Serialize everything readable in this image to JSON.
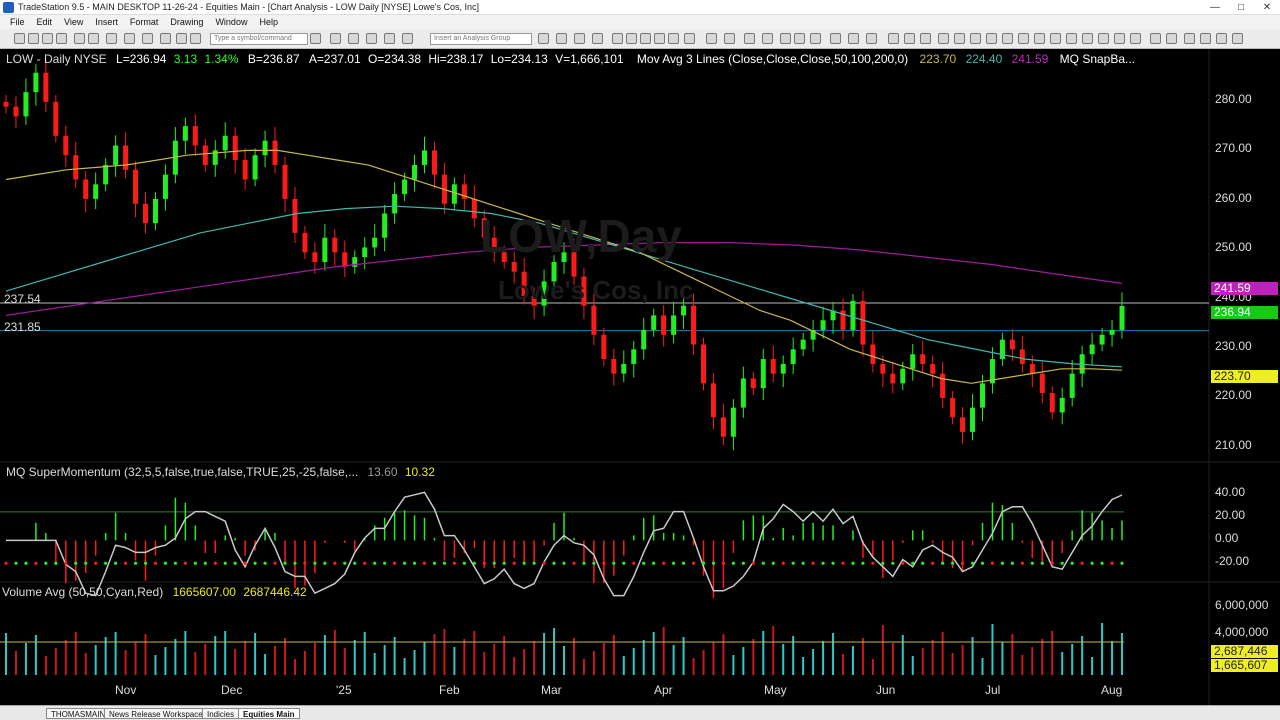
{
  "window": {
    "title": "TradeStation 9.5 - MAIN DESKTOP 11-26-24 - Equities Main - [Chart Analysis - LOW Daily [NYSE] Lowe's Cos, Inc]"
  },
  "menu": [
    "File",
    "Edit",
    "View",
    "Insert",
    "Format",
    "Drawing",
    "Window",
    "Help"
  ],
  "toolbar": {
    "symbol_placeholder": "Type a symbol/command",
    "analysis_placeholder": "Insert an Analysis Group"
  },
  "price_header": {
    "symbol": "LOW - Daily  NYSE",
    "last": "L=236.94",
    "change": "3.13",
    "pct": "1.34%",
    "bid": "B=236.87",
    "ask": "A=237.01",
    "open": "O=234.38",
    "high": "Hi=238.17",
    "low": "Lo=234.13",
    "volume": "V=1,666,101",
    "study": "Mov Avg 3 Lines (Close,Close,Close,50,100,200,0)",
    "ma1": "223.70",
    "ma2": "224.40",
    "ma3": "241.59",
    "snap": "MQ SnapBa..."
  },
  "watermark": {
    "symbol": "LOW,Day",
    "name": "Lowe's Cos, Inc"
  },
  "price_axis": [
    "280.00",
    "270.00",
    "260.00",
    "250.00",
    "240.00",
    "230.00",
    "220.00",
    "210.00"
  ],
  "price_levels": [
    "237.54",
    "231.85"
  ],
  "price_tags": {
    "ma200": "241.59",
    "last": "236.94",
    "ma50": "223.70"
  },
  "momentum": {
    "label": "MQ SuperMomentum (32,5,5,false,true,false,TRUE,25,-25,false,...",
    "v1": "13.60",
    "v2": "10.32",
    "axis": [
      "40.00",
      "20.00",
      "0.00",
      "-20.00"
    ]
  },
  "volume": {
    "label": "Volume Avg (50,50,Cyan,Red)",
    "v1": "1665607.00",
    "v2": "2687446.42",
    "axis": [
      "6,000,000",
      "4,000,000"
    ],
    "tag_avg": "2,687,446",
    "tag_vol": "1,665,607"
  },
  "time_axis": [
    "Nov",
    "Dec",
    "'25",
    "Feb",
    "Mar",
    "Apr",
    "May",
    "Jun",
    "Jul",
    "Aug"
  ],
  "tabs": [
    "THOMASMAIN",
    "News Release Workspace",
    "Indicies",
    "Equities Main"
  ],
  "colors": {
    "up": "#22ee22",
    "down": "#ff1a1a",
    "ma50": "#c8b84a",
    "ma100": "#3fb8b0",
    "ma200": "#a01aa0",
    "vol_up": "#2ec8c8",
    "vol_down": "#cc1a1a"
  },
  "chart_data": {
    "type": "candlestick",
    "symbol": "LOW",
    "interval": "Daily",
    "ylim": [
      205,
      287
    ],
    "closes": [
      278,
      276,
      281,
      285,
      279,
      272,
      268,
      263,
      259,
      262,
      266,
      270,
      265,
      258,
      254,
      259,
      264,
      271,
      274,
      270,
      266,
      269,
      272,
      267,
      263,
      268,
      271,
      266,
      259,
      252,
      248,
      246,
      251,
      248,
      245,
      247,
      249,
      251,
      256,
      260,
      263,
      266,
      269,
      264,
      258,
      262,
      259,
      255,
      251,
      248,
      246,
      244,
      239,
      237,
      242,
      246,
      248,
      243,
      237,
      231,
      226,
      223,
      225,
      228,
      232,
      235,
      231,
      235,
      237,
      229,
      221,
      214,
      210,
      216,
      222,
      220,
      226,
      223,
      225,
      228,
      230,
      232,
      234,
      236,
      232,
      238,
      229,
      225,
      223,
      221,
      224,
      227,
      225,
      223,
      218,
      214,
      211,
      216,
      221,
      226,
      230,
      228,
      225,
      223,
      219,
      215,
      218,
      223,
      227,
      229,
      231,
      232,
      236.94
    ],
    "ma50": [
      263,
      264,
      265,
      265.5,
      266,
      267,
      268,
      268.5,
      269,
      269,
      268,
      267,
      266,
      264,
      262,
      260,
      258,
      256,
      254,
      252,
      250,
      248,
      245,
      242,
      239,
      236,
      234,
      231,
      228,
      226,
      224,
      222,
      221,
      222,
      223,
      224,
      224,
      223.7
    ],
    "ma100": [
      240,
      243,
      246,
      249,
      252,
      254,
      256,
      257,
      257.5,
      257,
      256,
      254,
      251,
      248,
      245,
      242,
      239,
      236,
      233,
      230,
      228,
      226,
      225,
      224.4
    ],
    "ma200": [
      235,
      237,
      239,
      241,
      243,
      245,
      246.5,
      248,
      249,
      249.5,
      250,
      250,
      249.5,
      248.5,
      247,
      245.5,
      243.5,
      241.59
    ]
  }
}
